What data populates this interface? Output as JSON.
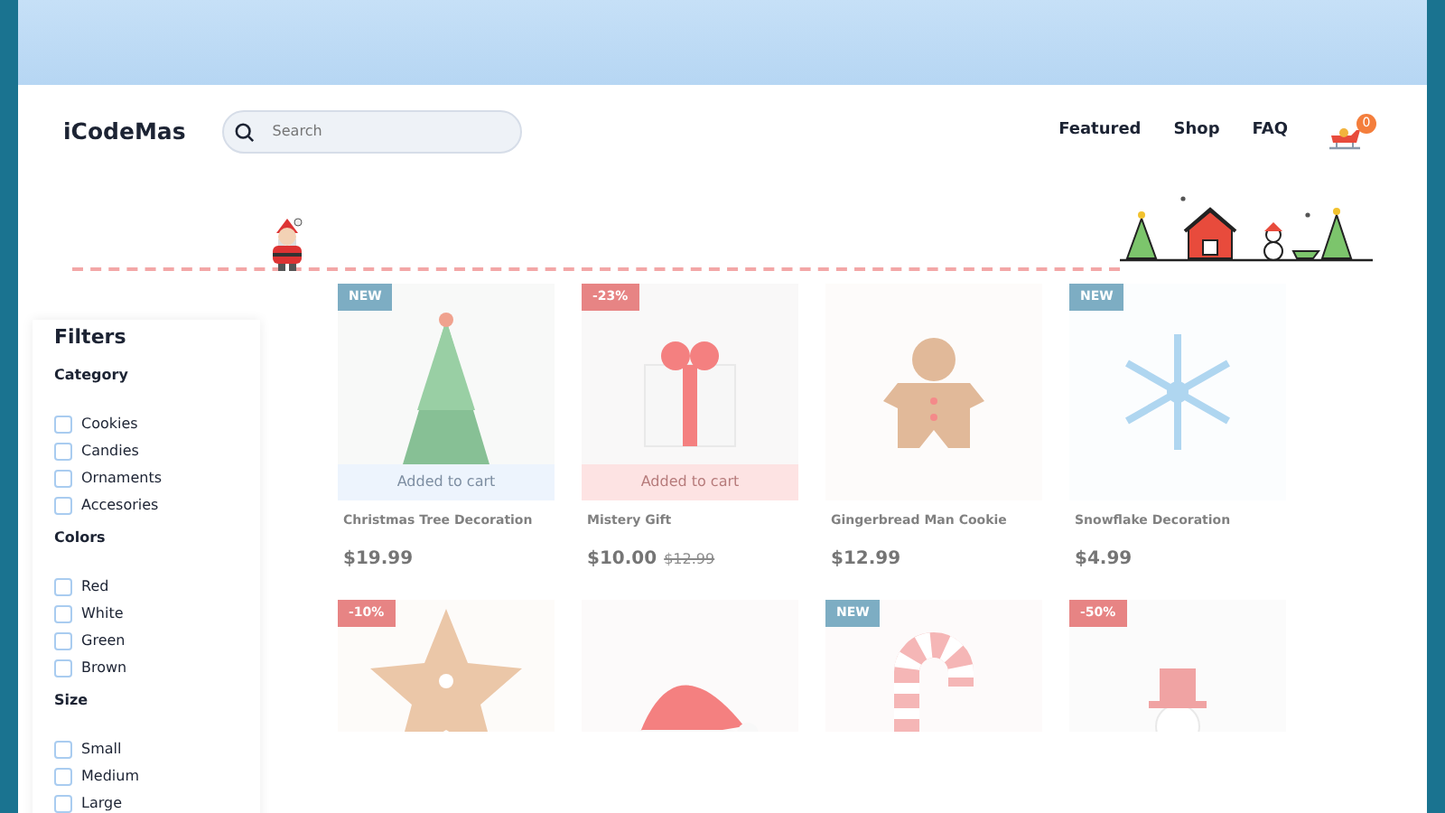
{
  "logo": "iCodeMas",
  "search": {
    "placeholder": "Search"
  },
  "nav": [
    {
      "label": "Featured"
    },
    {
      "label": "Shop"
    },
    {
      "label": "FAQ"
    }
  ],
  "cart": {
    "count": "0"
  },
  "filters": {
    "title": "Filters",
    "groups": [
      {
        "title": "Category",
        "options": [
          {
            "label": "Cookies",
            "checked": false
          },
          {
            "label": "Candies",
            "checked": false
          },
          {
            "label": "Ornaments",
            "checked": false
          },
          {
            "label": "Accesories",
            "checked": false
          }
        ]
      },
      {
        "title": "Colors",
        "options": [
          {
            "label": "Red",
            "checked": false
          },
          {
            "label": "White",
            "checked": false
          },
          {
            "label": "Green",
            "checked": false
          },
          {
            "label": "Brown",
            "checked": false
          }
        ]
      },
      {
        "title": "Size",
        "options": [
          {
            "label": "Small",
            "checked": false
          },
          {
            "label": "Medium",
            "checked": false
          },
          {
            "label": "Large",
            "checked": false
          }
        ]
      }
    ]
  },
  "products": [
    {
      "kind": "picture",
      "badge": {
        "text": "NEW",
        "kind": "new"
      },
      "cart_button": "Added to cart",
      "name": "Christmas Tree Decoration",
      "price": "$19.99"
    },
    {
      "kind": "picture",
      "badge": {
        "text": "-23%",
        "kind": "sale"
      },
      "cart_button": "Added to cart",
      "name": "Mistery Gift",
      "price": "$10.00",
      "old_price": "$12.99"
    },
    {
      "kind": "picture",
      "name": "Gingerbread Man Cookie",
      "price": "$12.99"
    },
    {
      "kind": "picture",
      "badge": {
        "text": "NEW",
        "kind": "new"
      },
      "name": "Snowflake Decoration",
      "price": "$4.99"
    },
    {
      "kind": "picture",
      "badge": {
        "text": "-10%",
        "kind": "sale"
      }
    },
    {
      "kind": "picture"
    },
    {
      "kind": "picture",
      "badge": {
        "text": "NEW",
        "kind": "new"
      }
    },
    {
      "kind": "picture",
      "badge": {
        "text": "-50%",
        "kind": "sale"
      }
    }
  ]
}
